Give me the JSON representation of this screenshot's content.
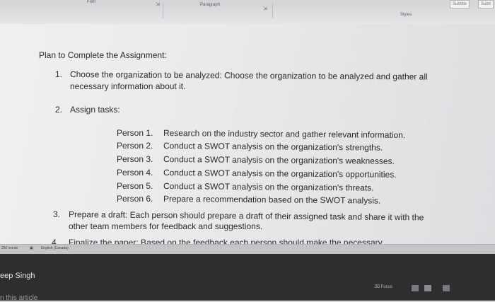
{
  "ribbon": {
    "font_group": "Font",
    "paragraph_group": "Paragraph",
    "styles_group": "Styles",
    "style_chip_1": "Subtitle",
    "style_chip_2": "Subtl"
  },
  "document": {
    "heading": "Plan to Complete the Assignment:",
    "items": [
      {
        "num": "1.",
        "line1": "Choose the organization to be analyzed: Choose the organization to be analyzed and gather all",
        "line2": "necessary information about it."
      },
      {
        "num": "2.",
        "line1": "Assign tasks:"
      },
      {
        "num": "3.",
        "line1": "Prepare a draft: Each person should prepare a draft of their assigned task and share it with the",
        "line2": "other team members for feedback and suggestions."
      },
      {
        "num": "4.",
        "line1": "Finalize the paper: Based on the feedback each person should make the necessary"
      }
    ],
    "persons": [
      {
        "label": "Person 1.",
        "task": "Research on the industry sector and gather relevant information."
      },
      {
        "label": "Person 2.",
        "task": "Conduct a SWOT analysis on the organization's strengths."
      },
      {
        "label": "Person 3.",
        "task": "Conduct a SWOT analysis on the organization's weaknesses."
      },
      {
        "label": "Person 4.",
        "task": "Conduct a SWOT analysis on the organization's opportunities."
      },
      {
        "label": "Person 5.",
        "task": "Conduct a SWOT analysis on the organization's threats."
      },
      {
        "label": "Person 6.",
        "task": "Prepare a recommendation based on the SWOT analysis."
      }
    ]
  },
  "status_bar": {
    "word_count": "250 words",
    "language": "English (Canada)",
    "focus": "Focus"
  },
  "taskbar": {
    "user_name": "eep Singh",
    "article_text": "n this article"
  }
}
